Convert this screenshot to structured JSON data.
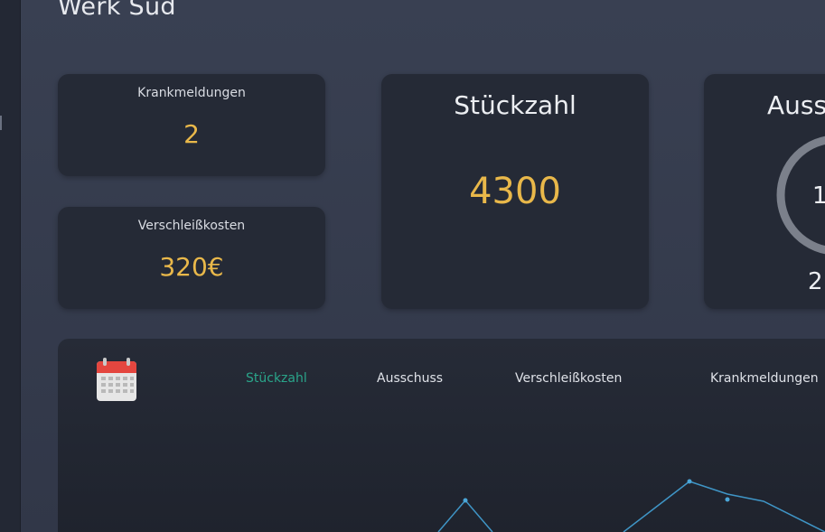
{
  "page": {
    "title": "Werk Süd"
  },
  "cards": {
    "krankmeldungen": {
      "label": "Krankmeldungen",
      "value": "2"
    },
    "verschleisskosten": {
      "label": "Verschleißkosten",
      "value": "320€"
    },
    "stueckzahl": {
      "label": "Stückzahl",
      "value": "4300"
    },
    "ausschuss": {
      "label": "Auss",
      "value": "1",
      "sub": "2"
    }
  },
  "chart_panel": {
    "icon": "calendar-icon",
    "tabs": [
      {
        "label": "Stückzahl",
        "active": true
      },
      {
        "label": "Ausschuss",
        "active": false
      },
      {
        "label": "Verschleißkosten",
        "active": false
      },
      {
        "label": "Krankmeldungen",
        "active": false
      }
    ]
  },
  "colors": {
    "accent_value": "#e9b84a",
    "active_tab": "#2aa58a",
    "line": "#3f95c6"
  }
}
